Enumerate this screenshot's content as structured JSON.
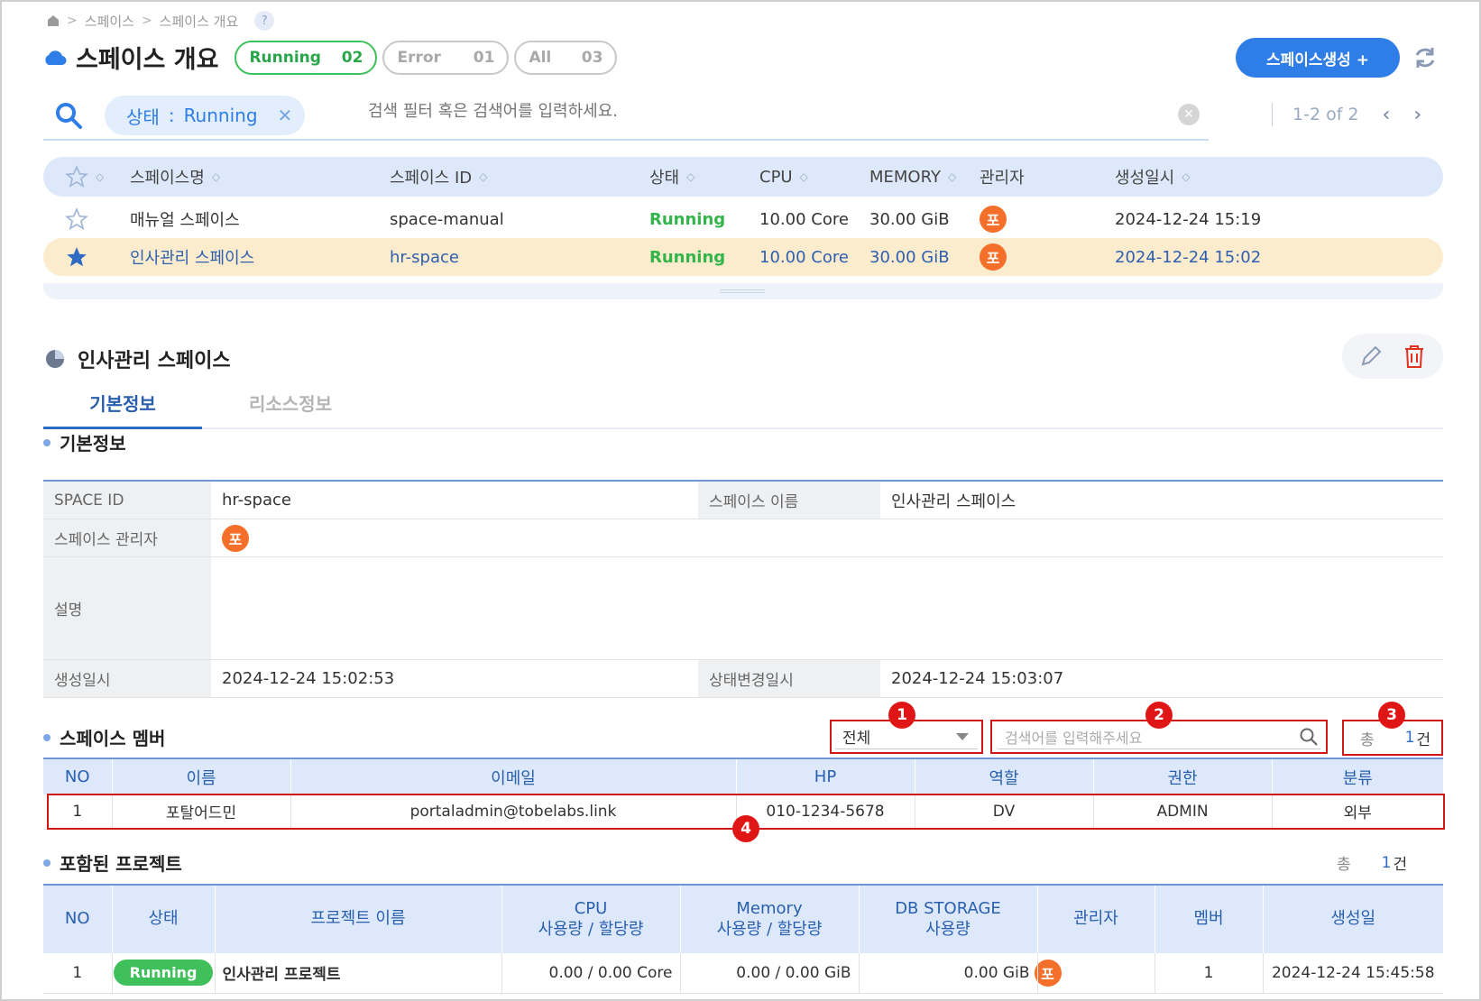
{
  "breadcrumb": {
    "items": [
      "스페이스",
      "스페이스 개요"
    ],
    "help": "?"
  },
  "header": {
    "title": "스페이스 개요",
    "status_pills": [
      {
        "label": "Running",
        "count": "02"
      },
      {
        "label": "Error",
        "count": "01"
      },
      {
        "label": "All",
        "count": "03"
      }
    ],
    "create_button": "스페이스생성 +"
  },
  "search": {
    "chip_key": "상태",
    "chip_sep": ":",
    "chip_value": "Running",
    "placeholder": "검색 필터 혹은 검색어를 입력하세요."
  },
  "pagination": {
    "range": "1-2 of 2"
  },
  "space_table": {
    "columns": [
      "스페이스명",
      "스페이스 ID",
      "상태",
      "CPU",
      "MEMORY",
      "관리자",
      "생성일시"
    ],
    "rows": [
      {
        "starred": false,
        "name": "매뉴얼 스페이스",
        "id": "space-manual",
        "status": "Running",
        "cpu": "10.00 Core",
        "memory": "30.00 GiB",
        "admin_initial": "포",
        "created": "2024-12-24 15:19"
      },
      {
        "starred": true,
        "name": "인사관리 스페이스",
        "id": "hr-space",
        "status": "Running",
        "cpu": "10.00 Core",
        "memory": "30.00 GiB",
        "admin_initial": "포",
        "created": "2024-12-24 15:02"
      }
    ]
  },
  "detail": {
    "title": "인사관리 스페이스",
    "tabs": [
      "기본정보",
      "리소스정보"
    ],
    "basic_section_title": "기본정보",
    "fields": {
      "space_id_label": "SPACE ID",
      "space_id": "hr-space",
      "space_name_label": "스페이스 이름",
      "space_name": "인사관리 스페이스",
      "admin_label": "스페이스 관리자",
      "admin_initial": "포",
      "desc_label": "설명",
      "desc": "",
      "created_label": "생성일시",
      "created": "2024-12-24 15:02:53",
      "changed_label": "상태변경일시",
      "changed": "2024-12-24 15:03:07"
    },
    "members": {
      "section_title": "스페이스 멤버",
      "filter_value": "전체",
      "search_placeholder": "검색어를 입력해주세요",
      "total_label": "총",
      "total_count": "1",
      "total_unit": "건",
      "columns": [
        "NO",
        "이름",
        "이메일",
        "HP",
        "역할",
        "권한",
        "분류"
      ],
      "rows": [
        {
          "no": "1",
          "name": "포탈어드민",
          "email": "portaladmin@tobelabs.link",
          "hp": "010-1234-5678",
          "role": "DV",
          "perm": "ADMIN",
          "type": "외부"
        }
      ]
    },
    "projects": {
      "section_title": "포함된 프로젝트",
      "total_label": "총",
      "total_count": "1",
      "total_unit": "건",
      "columns": [
        "NO",
        "상태",
        "프로젝트 이름",
        "CPU\n사용량 / 할당량",
        "Memory\n사용량 / 할당량",
        "DB STORAGE\n사용량",
        "관리자",
        "멤버",
        "생성일"
      ],
      "rows": [
        {
          "no": "1",
          "status": "Running",
          "name": "인사관리 프로젝트",
          "cpu": "0.00 / 0.00 Core",
          "memory": "0.00 / 0.00 GiB",
          "db": "0.00 GiB",
          "admin_initial": "포",
          "members": "1",
          "created": "2024-12-24 15:45:58"
        }
      ]
    }
  },
  "callouts": [
    "1",
    "2",
    "3",
    "4"
  ],
  "colors": {
    "accent": "#2f7de6",
    "running": "#3fc05b",
    "selected_row": "#fbeccd",
    "header_bg": "#dde9fb",
    "callout": "#e01616",
    "avatar": "#f36f2a"
  }
}
